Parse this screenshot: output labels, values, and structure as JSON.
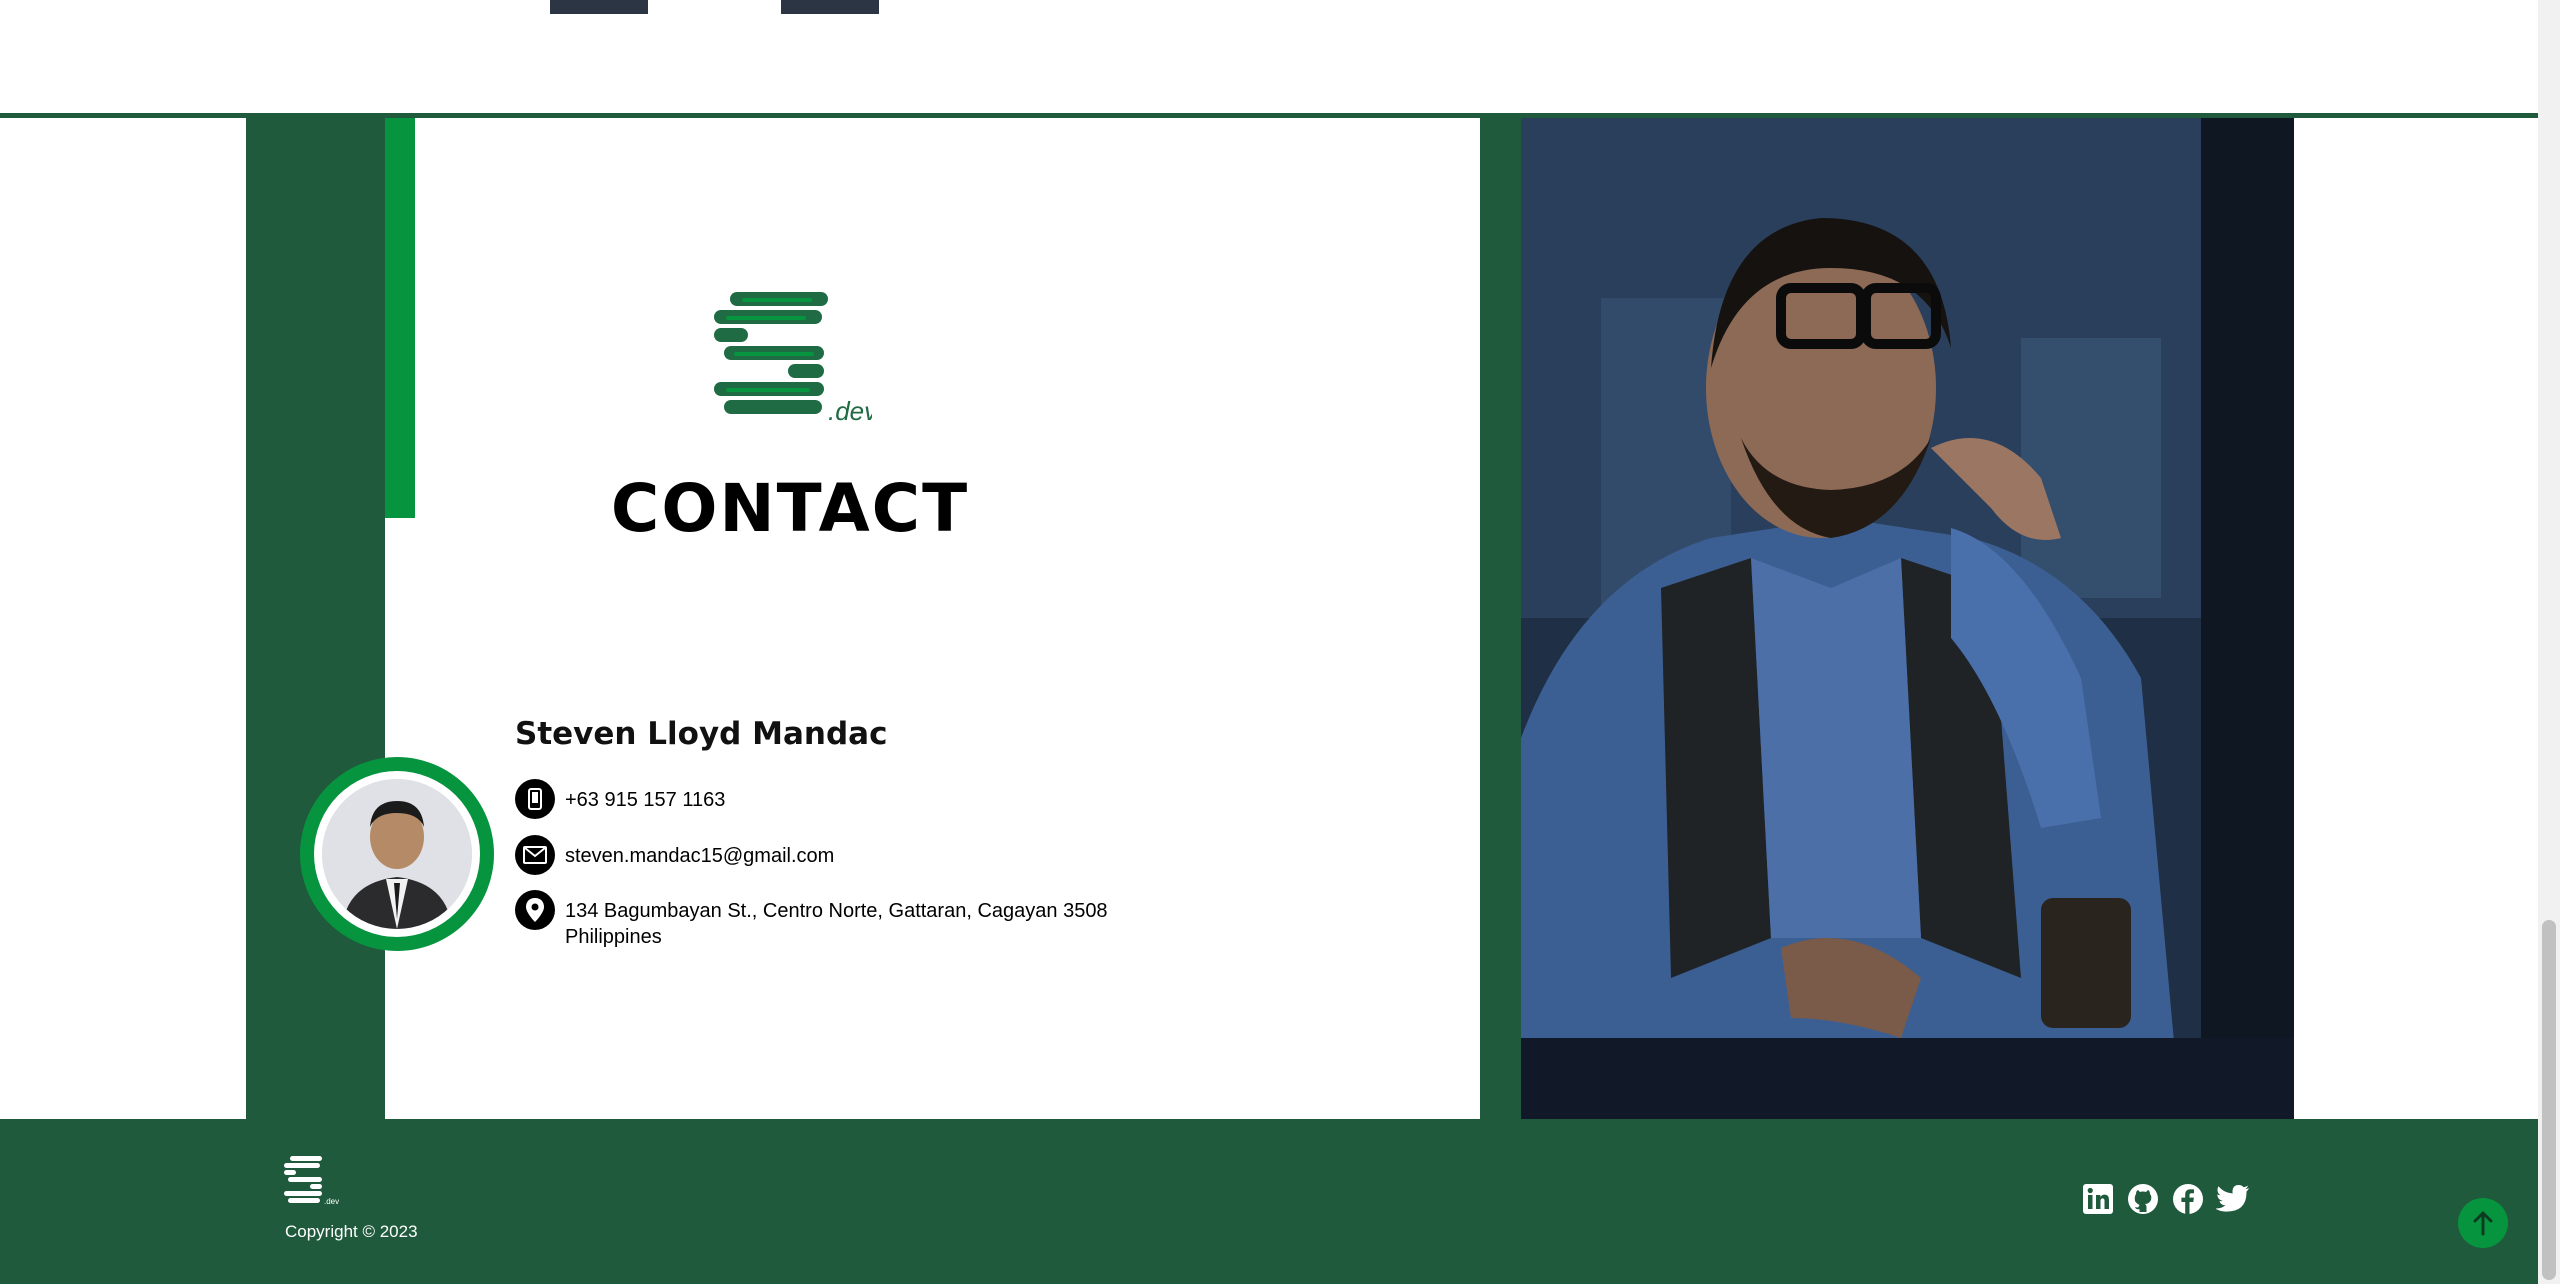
{
  "contact": {
    "title": "CONTACT",
    "logo_suffix": ".dev",
    "name": "Steven Lloyd Mandac",
    "phone": "+63 915 157 1163",
    "email": "steven.mandac15@gmail.com",
    "address_line1": "134 Bagumbayan St., Centro Norte, Gattaran, Cagayan 3508",
    "address_line2": "Philippines"
  },
  "footer": {
    "copyright": "Copyright © 2023",
    "social": [
      {
        "icon": "linkedin-icon"
      },
      {
        "icon": "github-icon"
      },
      {
        "icon": "facebook-icon"
      },
      {
        "icon": "twitter-icon"
      }
    ],
    "back_to_top_icon": "arrow-up-icon"
  },
  "colors": {
    "dark_green": "#1f5a3c",
    "accent_green": "#07943f",
    "slate": "#2b3543"
  }
}
